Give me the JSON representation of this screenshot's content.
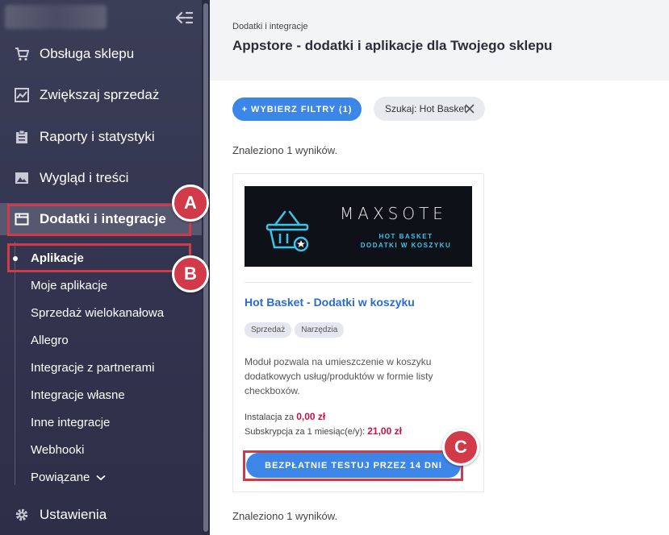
{
  "sidebar": {
    "items": [
      {
        "label": "Obsługa sklepu",
        "icon": "cart-icon"
      },
      {
        "label": "Zwiększaj sprzedaż",
        "icon": "chart-line-icon"
      },
      {
        "label": "Raporty i statystyki",
        "icon": "clipboard-icon"
      },
      {
        "label": "Wygląd i treści",
        "icon": "image-icon"
      },
      {
        "label": "Dodatki i integracje",
        "icon": "window-icon"
      },
      {
        "label": "Ustawienia",
        "icon": "gear-icon"
      }
    ],
    "sub_items": [
      "Aplikacje",
      "Moje aplikacje",
      "Sprzedaż wielokanałowa",
      "Allegro",
      "Integracje z partnerami",
      "Integracje własne",
      "Inne integracje",
      "Webhooki",
      "Powiązane"
    ]
  },
  "header": {
    "breadcrumb": "Dodatki i integracje",
    "title": "Appstore - dodatki i aplikacje dla Twojego sklepu"
  },
  "filters": {
    "button_label": "+ WYBIERZ FILTRY (1)",
    "search_chip": "Szukaj: Hot Basket"
  },
  "results": {
    "found_text": "Znaleziono 1 wyników."
  },
  "card": {
    "banner_brand": "MAXSOTE",
    "banner_line1": "HOT BASKET",
    "banner_line2": "DODATKI W KOSZYKU",
    "title": "Hot Basket - Dodatki w koszyku",
    "tags": [
      "Sprzedaż",
      "Narzędzia"
    ],
    "description": "Moduł pozwala na umieszczenie w koszyku dodatkowych usług/produktów w formie listy checkboxów.",
    "install_label": "Instalacja za",
    "install_price": "0,00 zł",
    "subscription_label": "Subskrypcja za 1 miesiąc(e/y):",
    "subscription_price": "21,00 zł",
    "trial_button": "BEZPŁATNIE TESTUJ PRZEZ 14 DNI"
  },
  "annotations": {
    "a": "A",
    "b": "B",
    "c": "C"
  },
  "colors": {
    "accent": "#3c86e8",
    "annotation": "#d23a4a",
    "price": "#c8104a",
    "link": "#2a6bd1"
  }
}
